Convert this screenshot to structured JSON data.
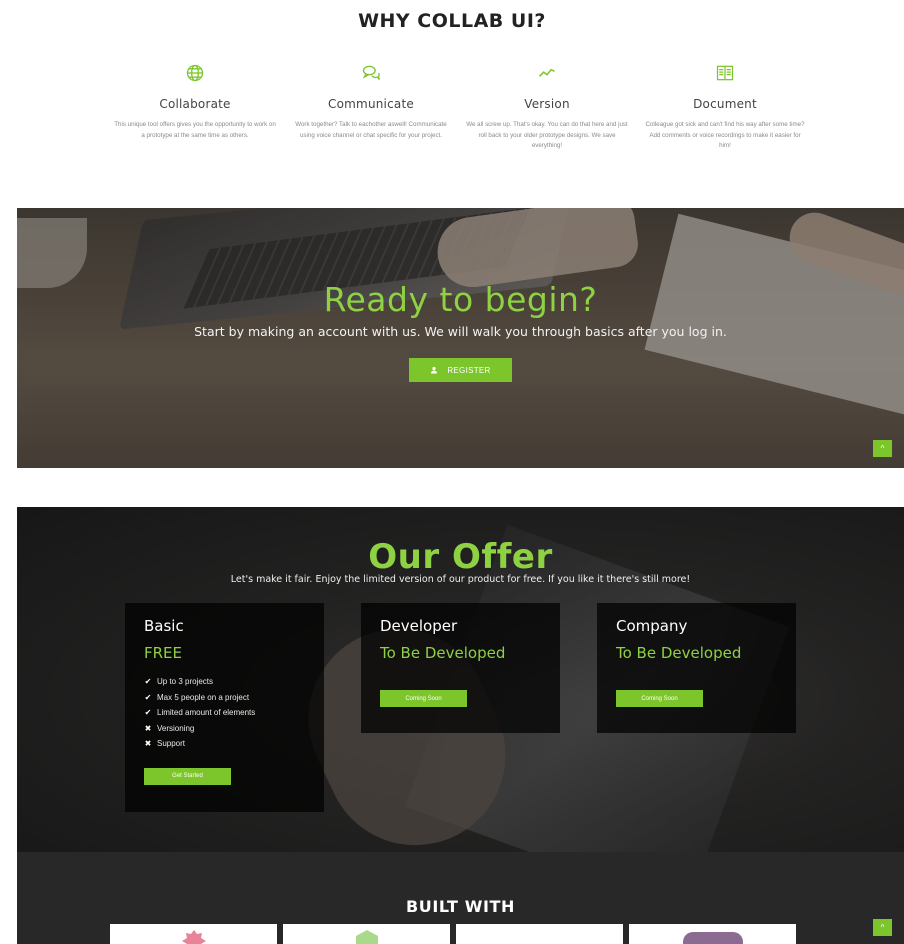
{
  "why": {
    "title": "WHY COLLAB UI?",
    "features": [
      {
        "icon": "globe-icon",
        "title": "Collaborate",
        "text": "This unique tool offers gives you the opportunity to work on a prototype at the same time as others."
      },
      {
        "icon": "chat-bubbles-icon",
        "title": "Communicate",
        "text": "Work together? Talk to eachother aswell! Communicate using voice channel or chat specific for your project."
      },
      {
        "icon": "line-chart-icon",
        "title": "Version",
        "text": "We all screw up. That's okay. You can do that here and just roll back to your older prototype designs. We save everything!"
      },
      {
        "icon": "book-icon",
        "title": "Document",
        "text": "Colleague got sick and can't find his way after some time? Add comments or voice recordings to make it easier for him!"
      }
    ]
  },
  "ready": {
    "title": "Ready to begin?",
    "subtitle": "Start by making an account with us. We will walk you through basics after you log in.",
    "register_label": "REGISTER"
  },
  "scroll_top": {
    "label": "^"
  },
  "offer": {
    "title": "Our Offer",
    "subtitle": "Let's make it fair. Enjoy the limited version of our product for free. If you like it there's still more!",
    "plans": [
      {
        "name": "Basic",
        "price": "FREE",
        "features": [
          {
            "mark": "✔",
            "text": "Up to 3 projects"
          },
          {
            "mark": "✔",
            "text": "Max 5 people on a project"
          },
          {
            "mark": "✔",
            "text": "Limited amount of elements"
          },
          {
            "mark": "✖",
            "text": "Versioning"
          },
          {
            "mark": "✖",
            "text": "Support"
          }
        ],
        "button": "Get Started"
      },
      {
        "name": "Developer",
        "price": "To Be Developed",
        "button": "Coming Soon"
      },
      {
        "name": "Company",
        "price": "To Be Developed",
        "button": "Coming Soon"
      }
    ]
  },
  "built_with": {
    "title": "BUILT WITH"
  },
  "colors": {
    "accent": "#7cc62b",
    "accent_text": "#8ed143"
  }
}
